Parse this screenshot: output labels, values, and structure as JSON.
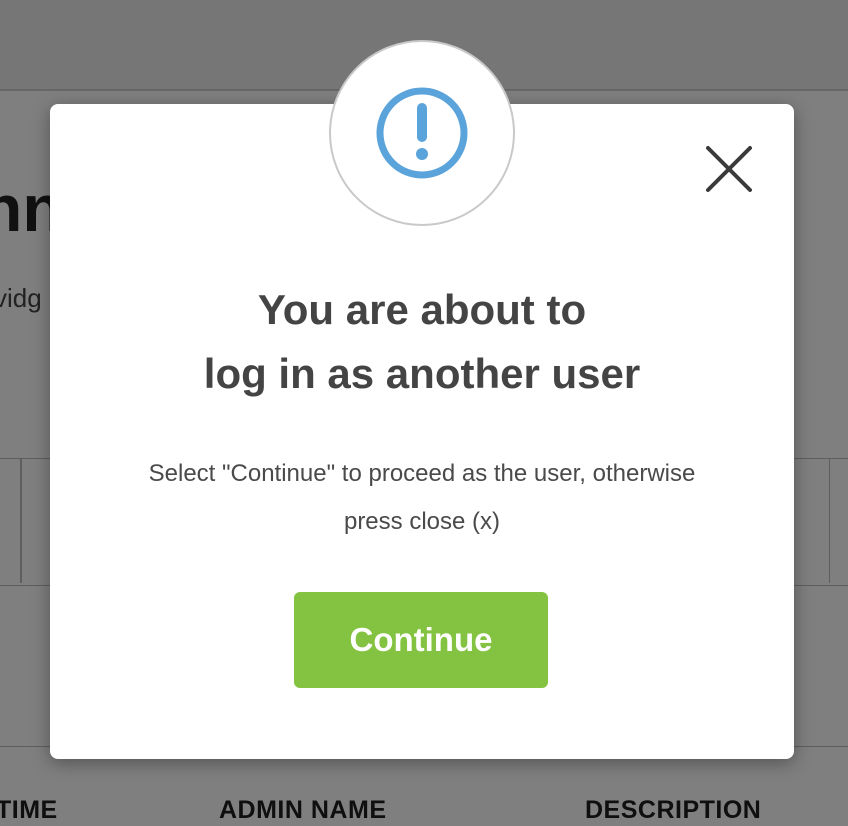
{
  "background": {
    "title_partial": "nn",
    "subtitle_partial": "vidg",
    "columns": [
      "TIME",
      "ADMIN NAME",
      "DESCRIPTION"
    ]
  },
  "modal": {
    "icon": "exclamation-circle-icon",
    "close_icon": "close-icon",
    "title_line1": "You are about to",
    "title_line2": "log in as another user",
    "text_line1": "Select \"Continue\" to proceed as the user, otherwise",
    "text_line2": "press close (x)",
    "continue_label": "Continue"
  },
  "colors": {
    "accent_green": "#84c341",
    "icon_blue": "#5ba3db",
    "title_text": "#444444"
  }
}
